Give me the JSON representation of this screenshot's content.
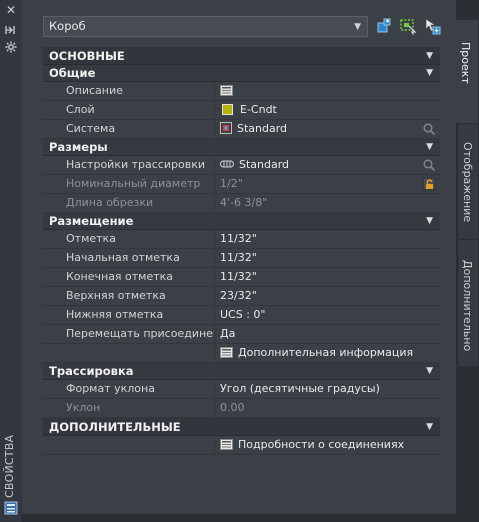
{
  "left_strip": {
    "close_glyph": "✕",
    "title": "СВОЙСТВА"
  },
  "header": {
    "object_type": "Короб",
    "dropdown_arrow": "▼"
  },
  "categories": {
    "main": "ОСНОВНЫЕ",
    "general": "Общие",
    "dimensions": "Размеры",
    "placement": "Размещение",
    "routing": "Трассировка",
    "extra": "ДОПОЛНИТЕЛЬНЫЕ"
  },
  "general": {
    "description_label": "Описание",
    "layer_label": "Слой",
    "layer_value": "E-Cndt",
    "layer_color": "#b5b500",
    "system_label": "Система",
    "system_value": "Standard"
  },
  "dimensions": {
    "routing_settings_label": "Настройки трассировки",
    "routing_settings_value": "Standard",
    "nominal_diameter_label": "Номинальный диаметр",
    "nominal_diameter_value": "1/2\"",
    "cut_length_label": "Длина обрезки",
    "cut_length_value": "4'-6 3/8\""
  },
  "placement": {
    "elevation_label": "Отметка",
    "elevation_value": "11/32\"",
    "start_elevation_label": "Начальная отметка",
    "start_elevation_value": "11/32\"",
    "end_elevation_label": "Конечная отметка",
    "end_elevation_value": "11/32\"",
    "top_elevation_label": "Верхняя отметка",
    "top_elevation_value": "23/32\"",
    "bottom_elevation_label": "Нижняя отметка",
    "bottom_elevation_value": "UCS : 0\"",
    "move_connected_label": "Перемещать  присоединенн...",
    "move_connected_value": "Да",
    "additional_info": "Дополнительная информация"
  },
  "routing": {
    "slope_format_label": "Формат уклона",
    "slope_format_value": "Угол (десятичные градусы)",
    "slope_label": "Уклон",
    "slope_value": "0.00"
  },
  "extra": {
    "connection_details": "Подробности о соединениях"
  },
  "tabs": {
    "project": "Проект",
    "display": "Отображение",
    "additional": "Дополнительно"
  },
  "icons": {
    "add_selection": "add-to-selection-icon",
    "quick_select": "quick-select-icon",
    "toggle_pickadd": "pickadd-toggle-icon",
    "pin": "pin-icon",
    "settings": "gear-icon",
    "lock": "lock-icon"
  },
  "colors": {
    "panel_bg": "#3b3f46",
    "category_bg": "#353940",
    "accent_blue": "#4fa3e0",
    "accent_green": "#6fcf3f",
    "lock_orange": "#e0a020"
  }
}
